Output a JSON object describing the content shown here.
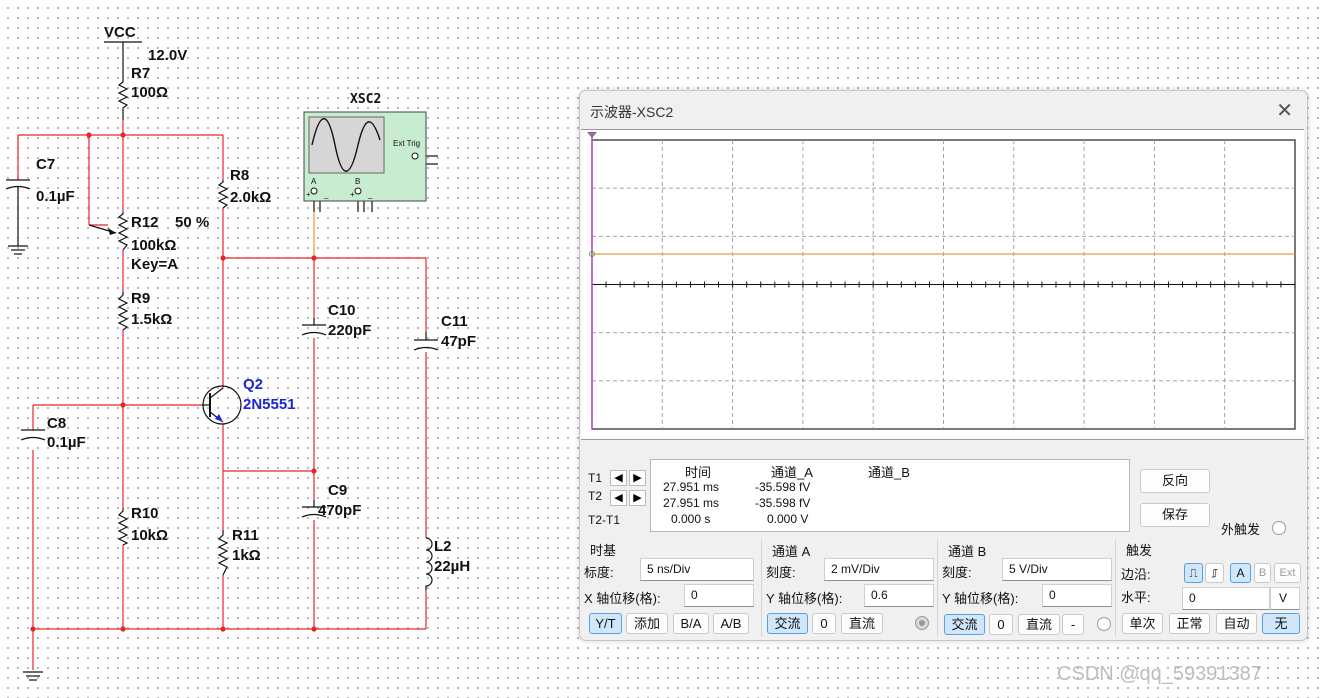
{
  "schematic": {
    "vcc_label": "VCC",
    "vcc_value": "12.0V",
    "components": {
      "r7": {
        "name": "R7",
        "value": "100Ω"
      },
      "r8": {
        "name": "R8",
        "value": "2.0kΩ"
      },
      "r12": {
        "name": "R12",
        "pct": "50 %",
        "value": "100kΩ",
        "key": "Key=A"
      },
      "r9": {
        "name": "R9",
        "value": "1.5kΩ"
      },
      "r10": {
        "name": "R10",
        "value": "10kΩ"
      },
      "r11": {
        "name": "R11",
        "value": "1kΩ"
      },
      "c7": {
        "name": "C7",
        "value": "0.1µF"
      },
      "c8": {
        "name": "C8",
        "value": "0.1µF"
      },
      "c9": {
        "name": "C9",
        "value": "470pF"
      },
      "c10": {
        "name": "C10",
        "value": "220pF"
      },
      "c11": {
        "name": "C11",
        "value": "47pF"
      },
      "l2": {
        "name": "L2",
        "value": "22µH"
      },
      "q2": {
        "name": "Q2",
        "value": "2N5551"
      }
    },
    "xsc2": {
      "name": "XSC2",
      "ext_trig": "Ext Trig",
      "ch_a": "A",
      "ch_b": "B",
      "plus": "+",
      "minus": "_"
    }
  },
  "oscilloscope": {
    "title": "示波器-XSC2",
    "close_glyph": "✕",
    "trace_color": "#e8a040",
    "cursor1_color": "#c23bd4",
    "cursor2_color": "#3cb043",
    "readout": {
      "t1": "T1",
      "t2": "T2",
      "t2t1": "T2-T1",
      "headers": {
        "time": "时间",
        "ch_a": "通道_A",
        "ch_b": "通道_B"
      },
      "rows": [
        {
          "time": "27.951 ms",
          "ch_a": "-35.598 fV",
          "ch_b": ""
        },
        {
          "time": "27.951 ms",
          "ch_a": "-35.598 fV",
          "ch_b": ""
        },
        {
          "time": "0.000 s",
          "ch_a": "0.000 V",
          "ch_b": ""
        }
      ]
    },
    "buttons": {
      "reverse": "反向",
      "save": "保存",
      "ext_trigger": "外触发"
    },
    "timebase": {
      "header": "时基",
      "scale_label": "标度:",
      "scale_value": "5 ns/Div",
      "xpos_label": "X 轴位移(格):",
      "xpos_value": "0",
      "modes": [
        "Y/T",
        "添加",
        "B/A",
        "A/B"
      ],
      "active_mode": "Y/T"
    },
    "channel_a": {
      "header": "通道 A",
      "scale_label": "刻度:",
      "scale_value": "2 mV/Div",
      "ypos_label": "Y 轴位移(格):",
      "ypos_value": "0.6",
      "coupling": [
        "交流",
        "0",
        "直流"
      ],
      "active_coupling": "交流"
    },
    "channel_b": {
      "header": "通道 B",
      "scale_label": "刻度:",
      "scale_value": "5  V/Div",
      "ypos_label": "Y 轴位移(格):",
      "ypos_value": "0",
      "coupling": [
        "交流",
        "0",
        "直流",
        "-"
      ],
      "active_coupling": "交流"
    },
    "trigger": {
      "header": "触发",
      "edge_label": "边沿:",
      "edge_rise": "⎍",
      "edge_fall": "⎎",
      "sources": [
        "A",
        "B",
        "Ext"
      ],
      "active_source": "A",
      "level_label": "水平:",
      "level_value": "0",
      "level_unit": "V",
      "modes": [
        "单次",
        "正常",
        "自动",
        "无"
      ],
      "active_mode": "无"
    }
  },
  "watermark": "CSDN @qq_59391387"
}
